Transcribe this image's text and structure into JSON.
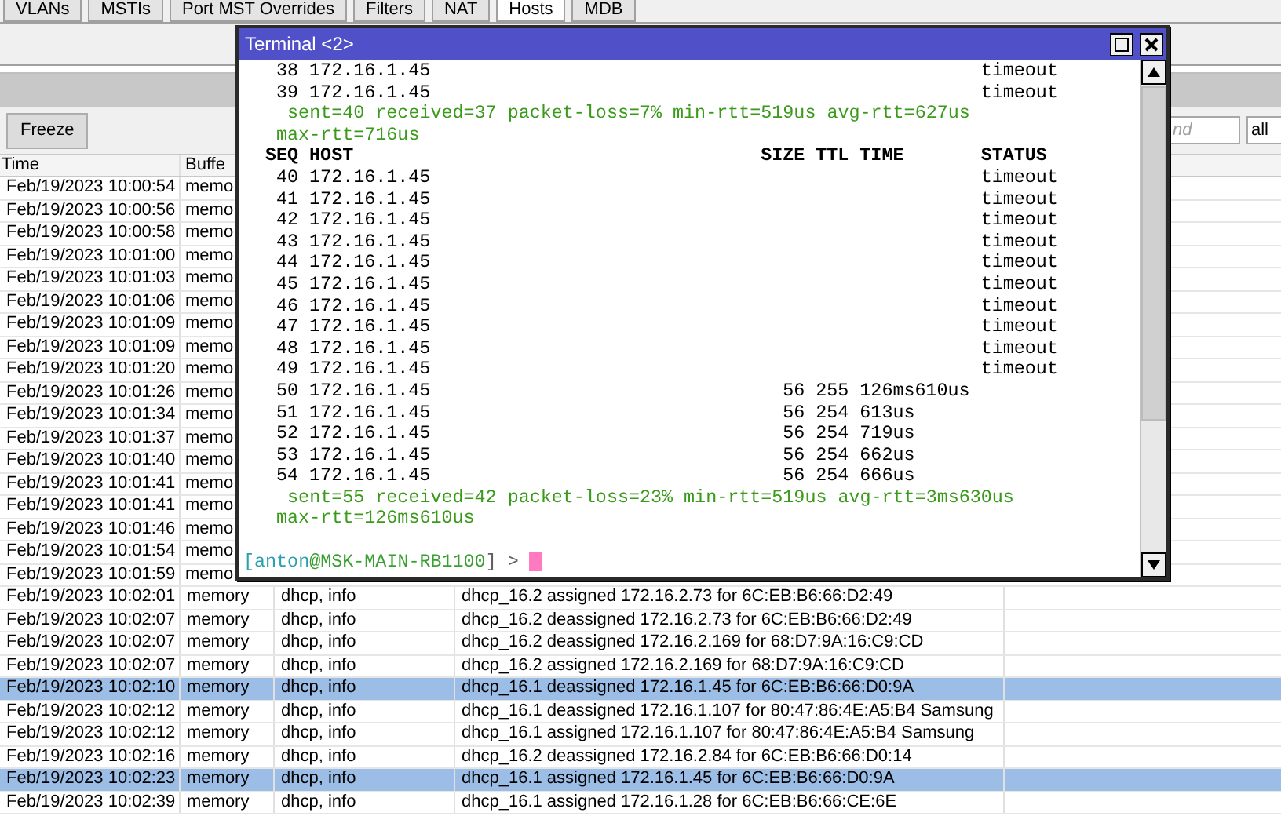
{
  "tabs": [
    {
      "label": "VLANs",
      "selected": false
    },
    {
      "label": "MSTIs",
      "selected": false
    },
    {
      "label": "Port MST Overrides",
      "selected": false
    },
    {
      "label": "Filters",
      "selected": false
    },
    {
      "label": "NAT",
      "selected": false
    },
    {
      "label": "Hosts",
      "selected": true
    },
    {
      "label": "MDB",
      "selected": false
    }
  ],
  "log_toolbar": {
    "freeze_button": "Freeze",
    "find": {
      "placeholder": "nd"
    },
    "filter": {
      "value": "all"
    }
  },
  "log_table": {
    "columns": [
      "Time",
      "Buffe"
    ],
    "rows": [
      {
        "time": "Feb/19/2023 10:00:54",
        "buffer": "memo",
        "selected": false
      },
      {
        "time": "Feb/19/2023 10:00:56",
        "buffer": "memo",
        "selected": false
      },
      {
        "time": "Feb/19/2023 10:00:58",
        "buffer": "memo",
        "selected": false
      },
      {
        "time": "Feb/19/2023 10:01:00",
        "buffer": "memo",
        "selected": false
      },
      {
        "time": "Feb/19/2023 10:01:03",
        "buffer": "memo",
        "selected": false
      },
      {
        "time": "Feb/19/2023 10:01:06",
        "buffer": "memo",
        "selected": false
      },
      {
        "time": "Feb/19/2023 10:01:09",
        "buffer": "memo",
        "selected": false
      },
      {
        "time": "Feb/19/2023 10:01:09",
        "buffer": "memo",
        "selected": false
      },
      {
        "time": "Feb/19/2023 10:01:20",
        "buffer": "memo",
        "selected": false
      },
      {
        "time": "Feb/19/2023 10:01:26",
        "buffer": "memo",
        "selected": false
      },
      {
        "time": "Feb/19/2023 10:01:34",
        "buffer": "memo",
        "selected": false
      },
      {
        "time": "Feb/19/2023 10:01:37",
        "buffer": "memo",
        "selected": false
      },
      {
        "time": "Feb/19/2023 10:01:40",
        "buffer": "memo",
        "selected": false
      },
      {
        "time": "Feb/19/2023 10:01:41",
        "buffer": "memo",
        "selected": false
      },
      {
        "time": "Feb/19/2023 10:01:41",
        "buffer": "memo",
        "selected": false
      },
      {
        "time": "Feb/19/2023 10:01:46",
        "buffer": "memo",
        "selected": false
      },
      {
        "time": "Feb/19/2023 10:01:54",
        "buffer": "memo",
        "selected": false
      },
      {
        "time": "Feb/19/2023 10:01:59",
        "buffer": "memo",
        "selected": false
      },
      {
        "time": "Feb/19/2023 10:02:01",
        "buffer": "memory",
        "topics": "dhcp, info",
        "message": "dhcp_16.2 assigned 172.16.2.73 for 6C:EB:B6:66:D2:49",
        "selected": false
      },
      {
        "time": "Feb/19/2023 10:02:07",
        "buffer": "memory",
        "topics": "dhcp, info",
        "message": "dhcp_16.2 deassigned 172.16.2.73 for 6C:EB:B6:66:D2:49",
        "selected": false
      },
      {
        "time": "Feb/19/2023 10:02:07",
        "buffer": "memory",
        "topics": "dhcp, info",
        "message": "dhcp_16.2 deassigned 172.16.2.169 for 68:D7:9A:16:C9:CD",
        "selected": false
      },
      {
        "time": "Feb/19/2023 10:02:07",
        "buffer": "memory",
        "topics": "dhcp, info",
        "message": "dhcp_16.2 assigned 172.16.2.169 for 68:D7:9A:16:C9:CD",
        "selected": false
      },
      {
        "time": "Feb/19/2023 10:02:10",
        "buffer": "memory",
        "topics": "dhcp, info",
        "message": "dhcp_16.1 deassigned 172.16.1.45 for 6C:EB:B6:66:D0:9A",
        "selected": true
      },
      {
        "time": "Feb/19/2023 10:02:12",
        "buffer": "memory",
        "topics": "dhcp, info",
        "message": "dhcp_16.1 deassigned 172.16.1.107 for 80:47:86:4E:A5:B4 Samsung",
        "selected": false
      },
      {
        "time": "Feb/19/2023 10:02:12",
        "buffer": "memory",
        "topics": "dhcp, info",
        "message": "dhcp_16.1 assigned 172.16.1.107 for 80:47:86:4E:A5:B4 Samsung",
        "selected": false
      },
      {
        "time": "Feb/19/2023 10:02:16",
        "buffer": "memory",
        "topics": "dhcp, info",
        "message": "dhcp_16.2 deassigned 172.16.2.84 for 6C:EB:B6:66:D0:14",
        "selected": false
      },
      {
        "time": "Feb/19/2023 10:02:23",
        "buffer": "memory",
        "topics": "dhcp, info",
        "message": "dhcp_16.1 assigned 172.16.1.45 for 6C:EB:B6:66:D0:9A",
        "selected": true
      },
      {
        "time": "Feb/19/2023 10:02:39",
        "buffer": "memory",
        "topics": "dhcp, info",
        "message": "dhcp_16.1 assigned 172.16.1.28 for 6C:EB:B6:66:CE:6E",
        "selected": false
      }
    ]
  },
  "terminal": {
    "title": "Terminal <2>",
    "lines": [
      {
        "kind": "row",
        "seq": "38",
        "host": "172.16.1.45",
        "status": "timeout"
      },
      {
        "kind": "row",
        "seq": "39",
        "host": "172.16.1.45",
        "status": "timeout"
      },
      {
        "kind": "stats",
        "text": "sent=40 received=37 packet-loss=7% min-rtt=519us avg-rtt=627us"
      },
      {
        "kind": "stats-wrap",
        "text": "max-rtt=716us"
      },
      {
        "kind": "header",
        "seq": "SEQ",
        "host": "HOST",
        "size": "SIZE",
        "ttl": "TTL",
        "time": "TIME",
        "status": "STATUS"
      },
      {
        "kind": "row",
        "seq": "40",
        "host": "172.16.1.45",
        "status": "timeout"
      },
      {
        "kind": "row",
        "seq": "41",
        "host": "172.16.1.45",
        "status": "timeout"
      },
      {
        "kind": "row",
        "seq": "42",
        "host": "172.16.1.45",
        "status": "timeout"
      },
      {
        "kind": "row",
        "seq": "43",
        "host": "172.16.1.45",
        "status": "timeout"
      },
      {
        "kind": "row",
        "seq": "44",
        "host": "172.16.1.45",
        "status": "timeout"
      },
      {
        "kind": "row",
        "seq": "45",
        "host": "172.16.1.45",
        "status": "timeout"
      },
      {
        "kind": "row",
        "seq": "46",
        "host": "172.16.1.45",
        "status": "timeout"
      },
      {
        "kind": "row",
        "seq": "47",
        "host": "172.16.1.45",
        "status": "timeout"
      },
      {
        "kind": "row",
        "seq": "48",
        "host": "172.16.1.45",
        "status": "timeout"
      },
      {
        "kind": "row",
        "seq": "49",
        "host": "172.16.1.45",
        "status": "timeout"
      },
      {
        "kind": "row",
        "seq": "50",
        "host": "172.16.1.45",
        "size": "56",
        "ttl": "255",
        "time": "126ms610us"
      },
      {
        "kind": "row",
        "seq": "51",
        "host": "172.16.1.45",
        "size": "56",
        "ttl": "254",
        "time": "613us"
      },
      {
        "kind": "row",
        "seq": "52",
        "host": "172.16.1.45",
        "size": "56",
        "ttl": "254",
        "time": "719us"
      },
      {
        "kind": "row",
        "seq": "53",
        "host": "172.16.1.45",
        "size": "56",
        "ttl": "254",
        "time": "662us"
      },
      {
        "kind": "row",
        "seq": "54",
        "host": "172.16.1.45",
        "size": "56",
        "ttl": "254",
        "time": "666us"
      },
      {
        "kind": "stats",
        "text": "sent=55 received=42 packet-loss=23% min-rtt=519us avg-rtt=3ms630us"
      },
      {
        "kind": "stats-wrap",
        "text": "max-rtt=126ms610us"
      },
      {
        "kind": "blank"
      },
      {
        "kind": "prompt",
        "parts": [
          {
            "text": "[anton",
            "color": "#2a9fb0"
          },
          {
            "text": "@MSK-MAIN-RB1100",
            "color": "#3aa032"
          },
          {
            "text": "] >",
            "color": "#606060"
          }
        ]
      }
    ]
  }
}
